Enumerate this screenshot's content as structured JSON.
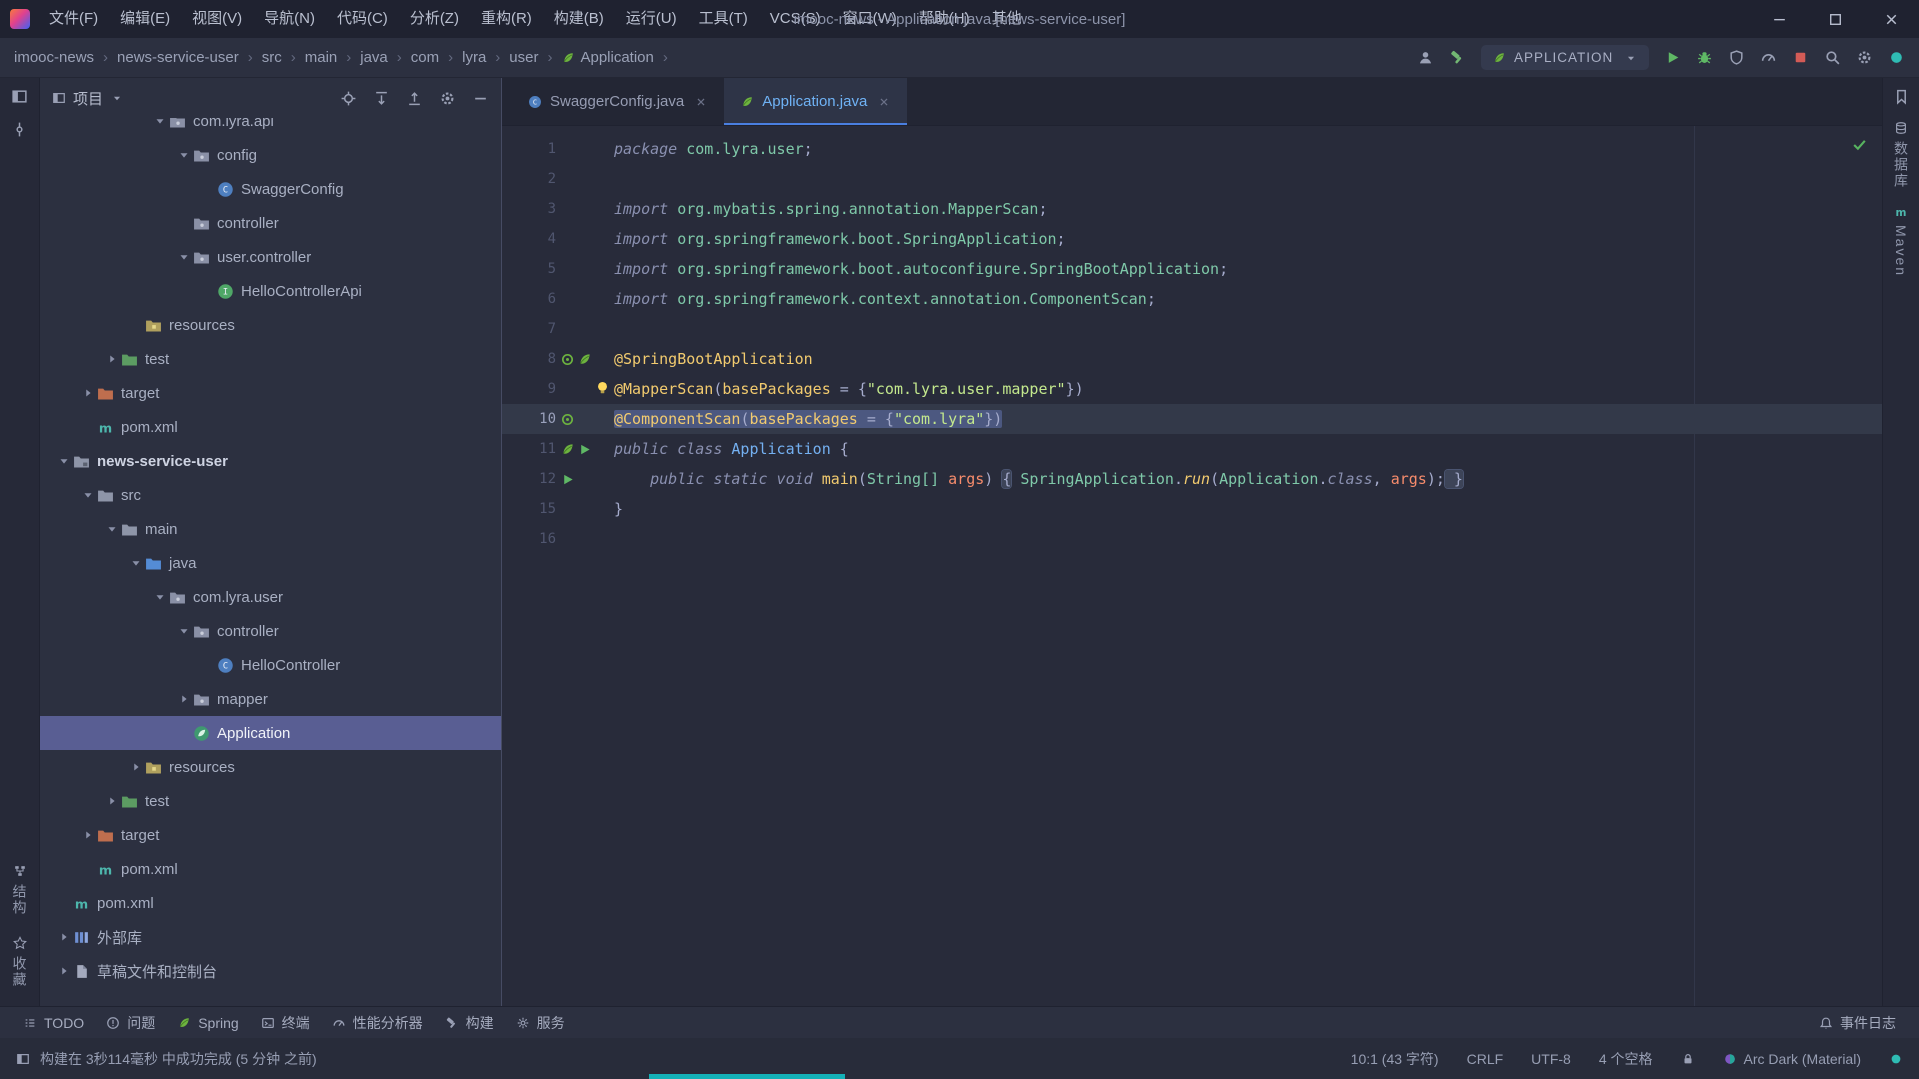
{
  "window": {
    "title": "imooc-news - Application.java [news-service-user]"
  },
  "menubar": {
    "items": [
      "文件(F)",
      "编辑(E)",
      "视图(V)",
      "导航(N)",
      "代码(C)",
      "分析(Z)",
      "重构(R)",
      "构建(B)",
      "运行(U)",
      "工具(T)",
      "VCS(S)",
      "窗口(W)",
      "帮助(H)",
      "其他"
    ]
  },
  "breadcrumb": {
    "separator": "›",
    "items": [
      {
        "label": "imooc-news"
      },
      {
        "label": "news-service-user"
      },
      {
        "label": "src"
      },
      {
        "label": "main"
      },
      {
        "label": "java"
      },
      {
        "label": "com"
      },
      {
        "label": "lyra"
      },
      {
        "label": "user"
      },
      {
        "label": "Application",
        "icon": "spring-leaf-icon"
      }
    ]
  },
  "nav": {
    "run_config": "APPLICATION"
  },
  "project": {
    "title": "项目",
    "tree": [
      {
        "label": "com.lyra.api",
        "depth": 4,
        "icon": "package-icon",
        "chevron": "down",
        "partial": true
      },
      {
        "label": "config",
        "depth": 5,
        "icon": "package-icon",
        "chevron": "down"
      },
      {
        "label": "SwaggerConfig",
        "depth": 6,
        "icon": "class-icon"
      },
      {
        "label": "controller",
        "depth": 5,
        "icon": "package-icon"
      },
      {
        "label": "user.controller",
        "depth": 5,
        "icon": "package-icon",
        "chevron": "down"
      },
      {
        "label": "HelloControllerApi",
        "depth": 6,
        "icon": "interface-icon"
      },
      {
        "label": "resources",
        "depth": 3,
        "icon": "resources-folder-icon"
      },
      {
        "label": "test",
        "depth": 2,
        "icon": "test-folder-icon",
        "chevron": "right"
      },
      {
        "label": "target",
        "depth": 1,
        "icon": "excluded-folder-icon",
        "chevron": "right"
      },
      {
        "label": "pom.xml",
        "depth": 1,
        "icon": "maven-icon"
      },
      {
        "label": "news-service-user",
        "depth": 0,
        "icon": "module-folder-icon",
        "chevron": "down",
        "bold": true
      },
      {
        "label": "src",
        "depth": 1,
        "icon": "folder-icon",
        "chevron": "down"
      },
      {
        "label": "main",
        "depth": 2,
        "icon": "folder-icon",
        "chevron": "down"
      },
      {
        "label": "java",
        "depth": 3,
        "icon": "sources-folder-icon",
        "chevron": "down"
      },
      {
        "label": "com.lyra.user",
        "depth": 4,
        "icon": "package-icon",
        "chevron": "down"
      },
      {
        "label": "controller",
        "depth": 5,
        "icon": "package-icon",
        "chevron": "down"
      },
      {
        "label": "HelloController",
        "depth": 6,
        "icon": "class-icon"
      },
      {
        "label": "mapper",
        "depth": 5,
        "icon": "package-icon",
        "chevron": "right"
      },
      {
        "label": "Application",
        "depth": 5,
        "icon": "spring-boot-class-icon",
        "selected": true
      },
      {
        "label": "resources",
        "depth": 3,
        "icon": "resources-folder-icon",
        "chevron": "right"
      },
      {
        "label": "test",
        "depth": 2,
        "icon": "test-folder-icon",
        "chevron": "right"
      },
      {
        "label": "target",
        "depth": 1,
        "icon": "excluded-folder-icon",
        "chevron": "right"
      },
      {
        "label": "pom.xml",
        "depth": 1,
        "icon": "maven-icon"
      },
      {
        "label": "pom.xml",
        "depth": 0,
        "icon": "maven-icon"
      },
      {
        "label": "外部库",
        "depth": 0,
        "icon": "libraries-icon",
        "chevron": "right"
      },
      {
        "label": "草稿文件和控制台",
        "depth": 0,
        "icon": "scratches-icon",
        "chevron": "right"
      }
    ]
  },
  "tabs": [
    {
      "label": "SwaggerConfig.java",
      "icon": "class-icon"
    },
    {
      "label": "Application.java",
      "icon": "spring-leaf-icon",
      "active": true
    }
  ],
  "editor": {
    "lines": [
      {
        "num": "1",
        "tokens": [
          {
            "t": "package ",
            "c": "kw"
          },
          {
            "t": "com.lyra.user",
            "c": "pkg"
          },
          {
            "t": ";",
            "c": "fg"
          }
        ]
      },
      {
        "num": "2",
        "tokens": []
      },
      {
        "num": "3",
        "tokens": [
          {
            "t": "import ",
            "c": "kw"
          },
          {
            "t": "org.mybatis.spring.annotation.MapperScan",
            "c": "pkg"
          },
          {
            "t": ";",
            "c": "fg"
          }
        ]
      },
      {
        "num": "4",
        "tokens": [
          {
            "t": "import ",
            "c": "kw"
          },
          {
            "t": "org.springframework.boot.SpringApplication",
            "c": "pkg"
          },
          {
            "t": ";",
            "c": "fg"
          }
        ]
      },
      {
        "num": "5",
        "tokens": [
          {
            "t": "import ",
            "c": "kw"
          },
          {
            "t": "org.springframework.boot.autoconfigure.SpringBootApplication",
            "c": "pkg"
          },
          {
            "t": ";",
            "c": "fg"
          }
        ]
      },
      {
        "num": "6",
        "tokens": [
          {
            "t": "import ",
            "c": "kw"
          },
          {
            "t": "org.springframework.context.annotation.ComponentScan",
            "c": "pkg"
          },
          {
            "t": ";",
            "c": "fg"
          }
        ]
      },
      {
        "num": "7",
        "tokens": []
      },
      {
        "num": "8",
        "gutter": [
          "spring-bean-icon",
          "spring-leaf-icon"
        ],
        "tokens": [
          {
            "t": "@SpringBootApplication",
            "c": "ann"
          }
        ]
      },
      {
        "num": "9",
        "bulb": true,
        "tokens": [
          {
            "t": "@MapperScan",
            "c": "ann"
          },
          {
            "t": "(",
            "c": "fg"
          },
          {
            "t": "basePackages",
            "c": "fld"
          },
          {
            "t": " = {",
            "c": "fg"
          },
          {
            "t": "\"com.lyra.user.mapper\"",
            "c": "str"
          },
          {
            "t": "})",
            "c": "fg"
          }
        ]
      },
      {
        "num": "10",
        "selected": true,
        "gutter": [
          "spring-bean-icon"
        ],
        "tokens": [
          {
            "t": "@ComponentScan",
            "c": "ann"
          },
          {
            "t": "(",
            "c": "fg"
          },
          {
            "t": "basePackages",
            "c": "fld"
          },
          {
            "t": " = {",
            "c": "fg"
          },
          {
            "t": "\"com.lyra\"",
            "c": "str"
          },
          {
            "t": "})",
            "c": "fg"
          }
        ]
      },
      {
        "num": "11",
        "gutter": [
          "spring-leaf-icon",
          "run-icon"
        ],
        "tokens": [
          {
            "t": "public class ",
            "c": "kw"
          },
          {
            "t": "Application",
            "c": "cls"
          },
          {
            "t": " {",
            "c": "fg"
          }
        ]
      },
      {
        "num": "12",
        "gutter": [
          "run-icon"
        ],
        "tokens": [
          {
            "t": "    ",
            "c": "fg"
          },
          {
            "t": "public static void ",
            "c": "kw"
          },
          {
            "t": "main",
            "c": "mth"
          },
          {
            "t": "(",
            "c": "fg"
          },
          {
            "t": "String[] ",
            "c": "pkg"
          },
          {
            "t": "args",
            "c": "prm"
          },
          {
            "t": ") ",
            "c": "fg"
          },
          {
            "t": "{",
            "c": "fold"
          },
          {
            "t": " ",
            "c": "fg"
          },
          {
            "t": "SpringApplication",
            "c": "pkg"
          },
          {
            "t": ".",
            "c": "fg"
          },
          {
            "t": "run",
            "c": "mthi"
          },
          {
            "t": "(",
            "c": "fg"
          },
          {
            "t": "Application",
            "c": "pkg"
          },
          {
            "t": ".",
            "c": "fg"
          },
          {
            "t": "class",
            "c": "kw"
          },
          {
            "t": ", ",
            "c": "fg"
          },
          {
            "t": "args",
            "c": "prm"
          },
          {
            "t": ");",
            "c": "fg"
          },
          {
            "t": " }",
            "c": "fold"
          }
        ]
      },
      {
        "num": "15",
        "tokens": [
          {
            "t": "}",
            "c": "fg"
          }
        ]
      },
      {
        "num": "16",
        "tokens": []
      }
    ]
  },
  "tool_buttons": {
    "left": [
      {
        "label": "TODO",
        "icon": "todo-icon"
      },
      {
        "label": "问题",
        "icon": "problems-icon"
      },
      {
        "label": "Spring",
        "icon": "spring-leaf-icon"
      },
      {
        "label": "终端",
        "icon": "terminal-icon"
      },
      {
        "label": "性能分析器",
        "icon": "profiler-icon"
      },
      {
        "label": "构建",
        "icon": "build-icon"
      },
      {
        "label": "服务",
        "icon": "services-icon"
      }
    ],
    "right": [
      {
        "label": "事件日志",
        "icon": "event-log-icon"
      }
    ]
  },
  "statusbar": {
    "message": "构建在 3秒114毫秒 中成功完成 (5 分钟 之前)",
    "caret": "10:1 (43 字符)",
    "line_ending": "CRLF",
    "encoding": "UTF-8",
    "indent": "4 个空格",
    "theme": "Arc Dark (Material)"
  },
  "stripes": {
    "left_bottom": [
      {
        "label": "结构"
      },
      {
        "label": "收藏"
      }
    ],
    "right": [
      {
        "label": "数据库"
      },
      {
        "label": "Maven"
      }
    ]
  },
  "colors": {
    "tree_selection": "#595e93",
    "run_green": "#5fb865",
    "stop_red": "#d35b56",
    "spring_green": "#6db33f",
    "accent_teal": "#14b1b7",
    "active_tab_blue": "#6fb2f5"
  }
}
